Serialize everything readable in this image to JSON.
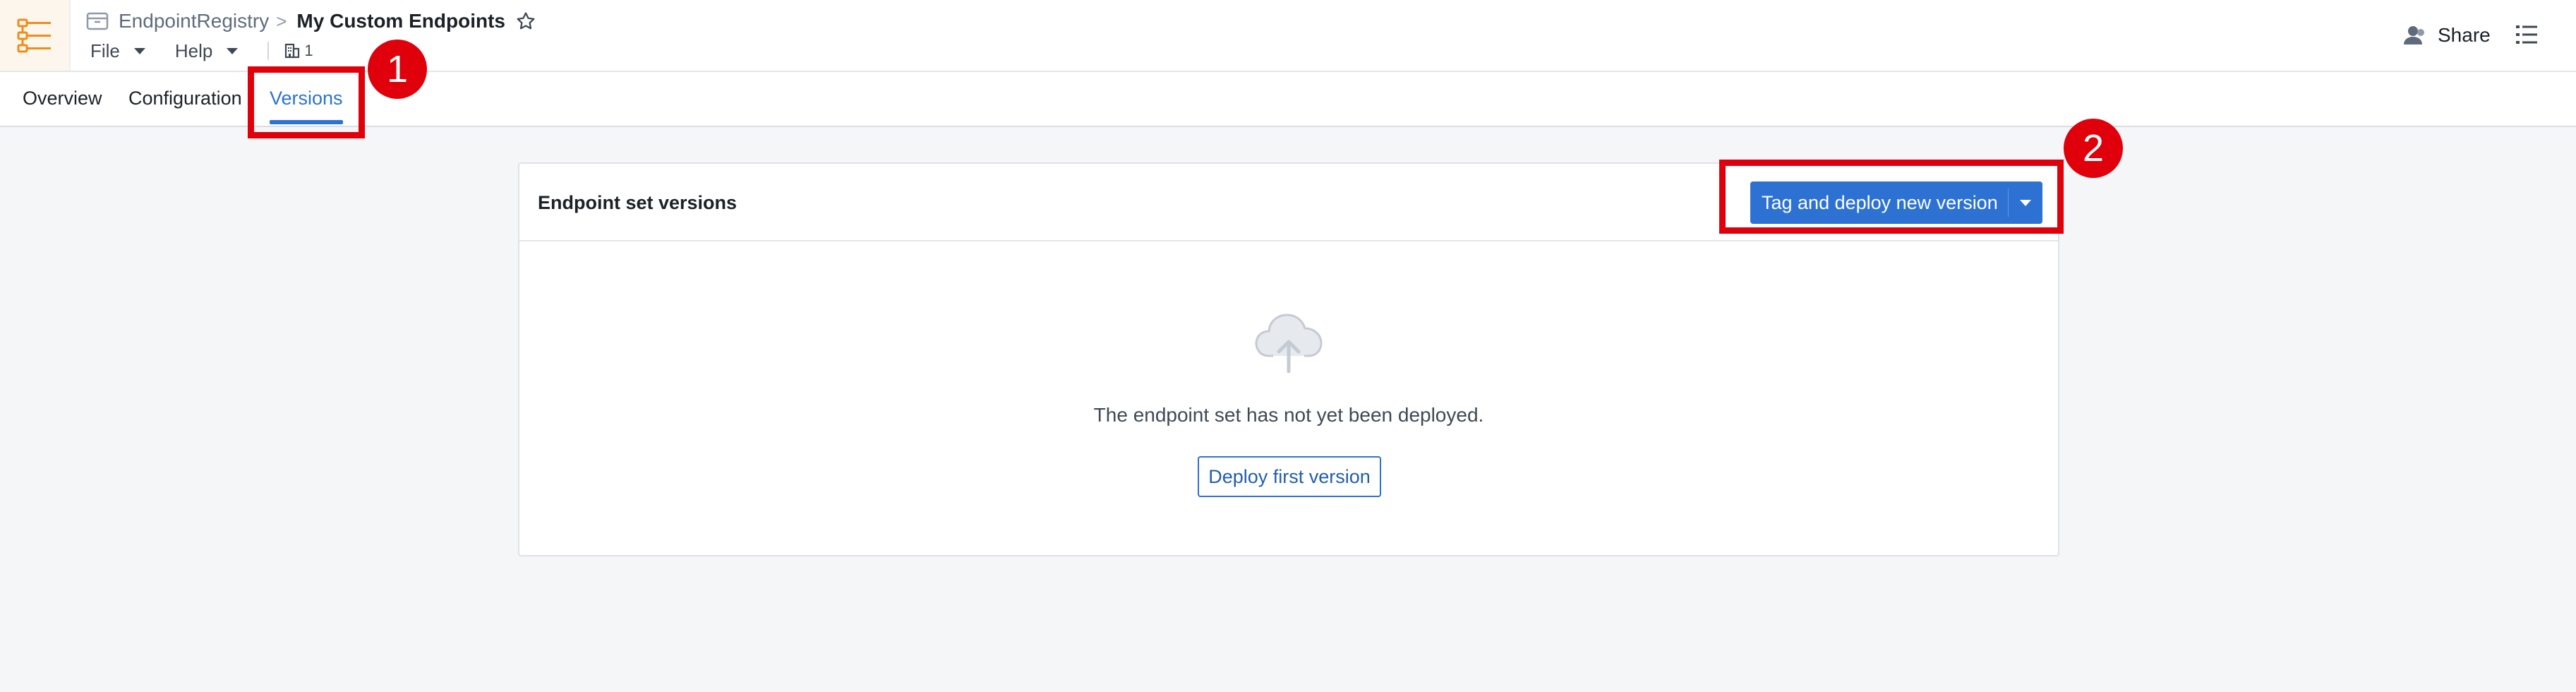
{
  "header": {
    "app_icon": "endpoint-registry-app-icon",
    "breadcrumb": {
      "folder_icon": "folder-icon",
      "parent": "EndpointRegistry",
      "separator": ">",
      "title": "My Custom Endpoints",
      "star_icon": "star-icon"
    },
    "menus": [
      {
        "label": "File"
      },
      {
        "label": "Help"
      }
    ],
    "building_count": "1",
    "share_label": "Share",
    "share_icon": "person-icon",
    "list_icon": "properties-list-icon"
  },
  "tabs": [
    {
      "label": "Overview",
      "active": false
    },
    {
      "label": "Configuration",
      "active": false
    },
    {
      "label": "Versions",
      "active": true
    }
  ],
  "annotations": [
    {
      "number": "1",
      "target": "Versions tab"
    },
    {
      "number": "2",
      "target": "Tag and deploy new version button"
    }
  ],
  "panel": {
    "title": "Endpoint set versions",
    "deploy_button": "Tag and deploy new version",
    "empty_icon": "cloud-upload-icon",
    "empty_message": "The endpoint set has not yet been deployed.",
    "first_button": "Deploy first version"
  },
  "colors": {
    "accent": "#2d72d2",
    "annotation": "#e0000b",
    "background": "#f5f6f8",
    "app_icon": "#f08c1a"
  }
}
